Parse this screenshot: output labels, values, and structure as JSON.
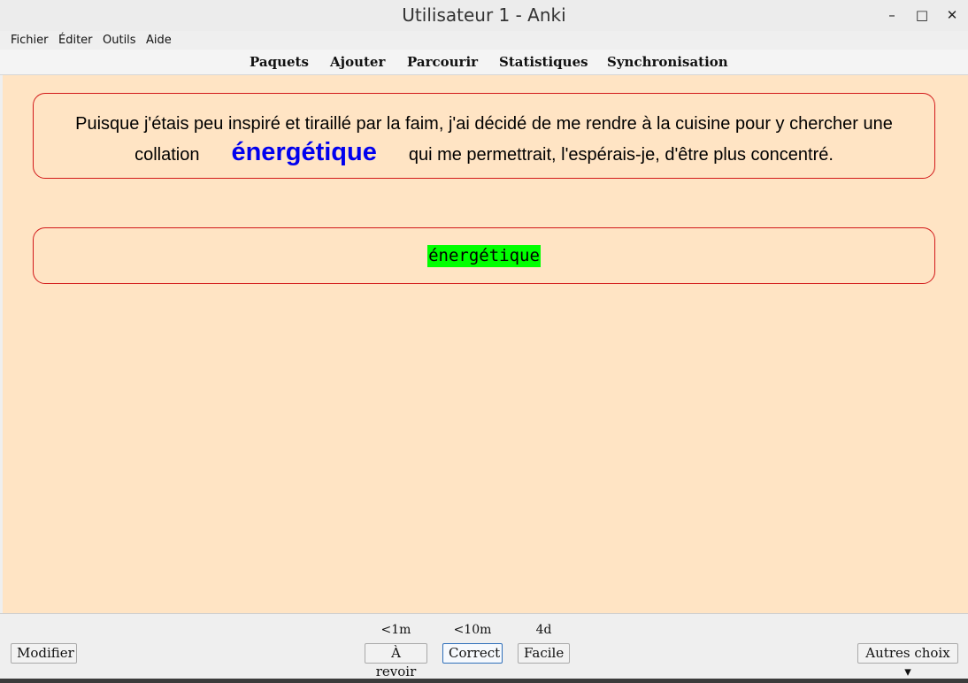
{
  "window": {
    "title": "Utilisateur 1 - Anki"
  },
  "controls": {
    "minimize": "–",
    "maximize": "□",
    "close": "✕"
  },
  "menu": {
    "items": [
      "Fichier",
      "Éditer",
      "Outils",
      "Aide"
    ]
  },
  "toolbar": {
    "items": [
      "Paquets",
      "Ajouter",
      "Parcourir",
      "Statistiques",
      "Synchronisation"
    ]
  },
  "card": {
    "sentence_before": "Puisque j'étais peu inspiré et tiraillé par la faim, j'ai décidé de me rendre à la cuisine pour y chercher une collation",
    "cloze": "énergétique",
    "sentence_after": "qui me permettrait, l'espérais-je, d'être plus concentré.",
    "typed_answer": "énergétique"
  },
  "review": {
    "edit_label": "Modifier",
    "more_label": "Autres choix ▾",
    "intervals": [
      "<1m",
      "<10m",
      "4d"
    ],
    "buttons": [
      "À revoir",
      "Correct",
      "Facile"
    ]
  },
  "colors": {
    "card_background": "#ffe4c4",
    "card_border": "#d21919",
    "cloze_color": "#0000ee",
    "typed_highlight": "#00ff00"
  }
}
